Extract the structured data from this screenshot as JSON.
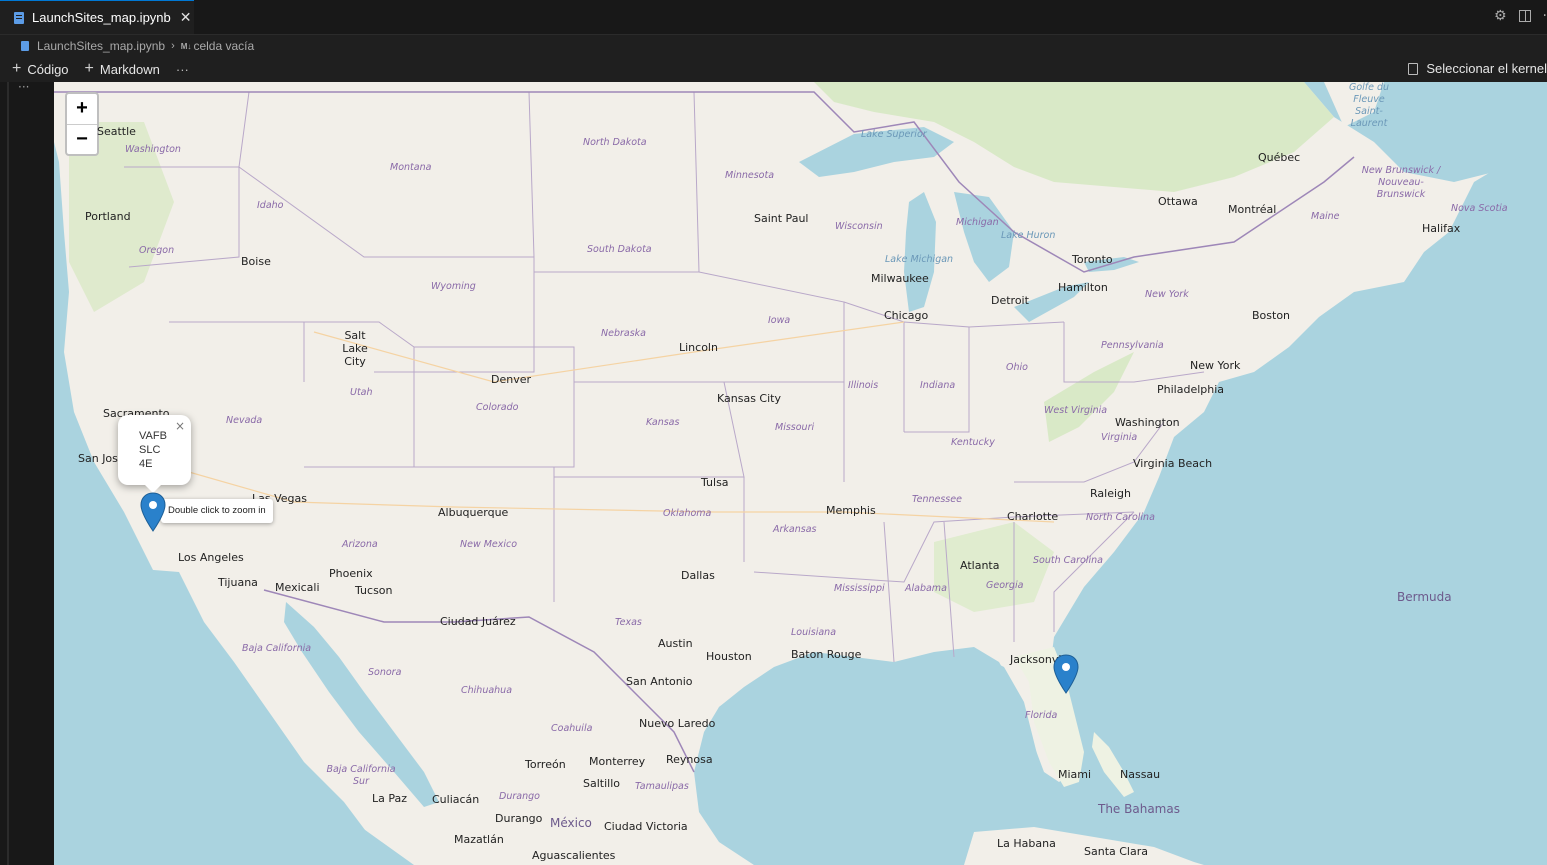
{
  "tab": {
    "filename": "LaunchSites_map.ipynb"
  },
  "breadcrumb": {
    "file": "LaunchSites_map.ipynb",
    "cell_badge": "M↓",
    "cell": "celda vacía"
  },
  "toolbar": {
    "code_label": "Código",
    "markdown_label": "Markdown",
    "more": "···",
    "kernel_label": "Seleccionar el kernel"
  },
  "gutter": {
    "dots": "···"
  },
  "map": {
    "zoom_in": "+",
    "zoom_out": "−",
    "popup_lines": [
      "VAFB",
      "SLC",
      "4E"
    ],
    "popup_close": "×",
    "tooltip": "Double click to zoom in",
    "cities": [
      "Seattle",
      "Portland",
      "Boise",
      "Salt Lake City",
      "Sacramento",
      "San Jose",
      "Las Vegas",
      "Los Angeles",
      "Tijuana",
      "Mexicali",
      "Phoenix",
      "Tucson",
      "Albuquerque",
      "Denver",
      "Ciudad Juárez",
      "Saint Paul",
      "Lincoln",
      "Kansas City",
      "Tulsa",
      "Dallas",
      "Austin",
      "San Antonio",
      "Houston",
      "Nuevo Laredo",
      "Reynosa",
      "Monterrey",
      "Saltillo",
      "Torreón",
      "Culiacán",
      "La Paz",
      "Durango",
      "Mazatlán",
      "Ciudad Victoria",
      "Aguascalientes",
      "Memphis",
      "Baton Rouge",
      "Milwaukee",
      "Chicago",
      "Detroit",
      "Toronto",
      "Hamilton",
      "Ottawa",
      "Montréal",
      "Québec",
      "Halifax",
      "Boston",
      "New York",
      "Philadelphia",
      "Washington",
      "Virginia Beach",
      "Raleigh",
      "Charlotte",
      "Atlanta",
      "Jacksonville",
      "Miami",
      "Nassau",
      "La Habana",
      "Santa Clara"
    ],
    "regions": [
      "Washington",
      "Oregon",
      "Idaho",
      "Montana",
      "Wyoming",
      "Nevada",
      "Utah",
      "Colorado",
      "Arizona",
      "New Mexico",
      "North Dakota",
      "South Dakota",
      "Nebraska",
      "Kansas",
      "Oklahoma",
      "Texas",
      "Minnesota",
      "Iowa",
      "Missouri",
      "Arkansas",
      "Louisiana",
      "Mississippi",
      "Alabama",
      "Tennessee",
      "Kentucky",
      "Illinois",
      "Indiana",
      "Ohio",
      "Wisconsin",
      "Michigan",
      "Pennsylvania",
      "New York",
      "West Virginia",
      "Virginia",
      "North Carolina",
      "South Carolina",
      "Georgia",
      "Florida",
      "Maine",
      "Nova Scotia",
      "New Brunswick / Nouveau-Brunswick",
      "Baja California",
      "Baja California Sur",
      "Sonora",
      "Chihuahua",
      "Coahuila",
      "Durango",
      "Tamaulipas"
    ],
    "water": [
      "Lake Superior",
      "Lake Michigan",
      "Lake Huron",
      "Golfe du Fleuve Saint-Laurent"
    ],
    "countries": [
      "México",
      "Bermuda",
      "The Bahamas"
    ],
    "colors": {
      "land": "#f2efe9",
      "water": "#aad3df",
      "marker": "#2a81cb",
      "border": "#b9a8c9"
    }
  }
}
